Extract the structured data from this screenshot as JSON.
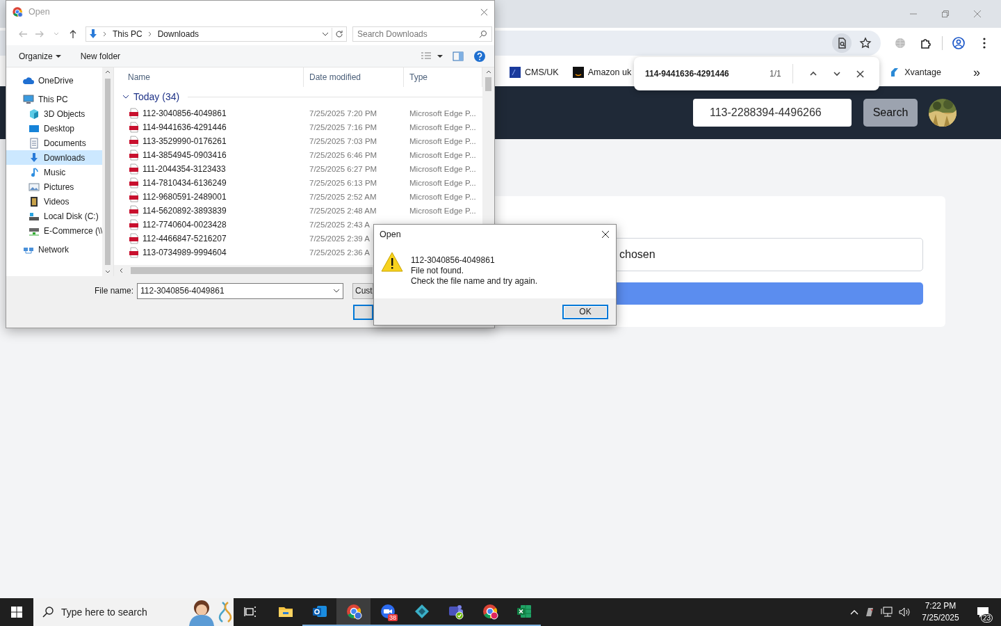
{
  "browser": {
    "bookmarks": [
      {
        "label": "CMS/UK",
        "kind": "df"
      },
      {
        "label": "Amazon uk",
        "kind": "amazon"
      }
    ],
    "bookmarks_right": [
      {
        "label": "Xvantage",
        "kind": "xvantage"
      }
    ],
    "bookmarks_overflow": "»",
    "find_bar": {
      "query": "114-9441636-4291446",
      "count": "1/1"
    },
    "header": {
      "search_value": "113-2288394-4496266",
      "search_button": "Search"
    },
    "upload_card": {
      "file_status": "chosen"
    }
  },
  "file_dialog": {
    "title": "Open",
    "path": [
      "This PC",
      "Downloads"
    ],
    "search_placeholder": "Search Downloads",
    "toolbar": [
      "Organize",
      "New folder"
    ],
    "sidebar": [
      {
        "label": "OneDrive",
        "kind": "onedrive",
        "selected": false
      },
      {
        "label": "This PC",
        "kind": "pc",
        "selected": false,
        "children": [
          {
            "label": "3D Objects",
            "kind": "objects3d",
            "selected": false
          },
          {
            "label": "Desktop",
            "kind": "desktop",
            "selected": false
          },
          {
            "label": "Documents",
            "kind": "documents",
            "selected": false
          },
          {
            "label": "Downloads",
            "kind": "downloads",
            "selected": true
          },
          {
            "label": "Music",
            "kind": "music",
            "selected": false
          },
          {
            "label": "Pictures",
            "kind": "pictures",
            "selected": false
          },
          {
            "label": "Videos",
            "kind": "videos",
            "selected": false
          },
          {
            "label": "Local Disk (C:)",
            "kind": "disk",
            "selected": false
          },
          {
            "label": "E-Commerce (\\\\",
            "kind": "netdrive",
            "selected": false
          }
        ]
      },
      {
        "label": "Network",
        "kind": "network",
        "selected": false
      }
    ],
    "columns": [
      "Name",
      "Date modified",
      "Type"
    ],
    "group": "Today (34)",
    "files": [
      {
        "name": "112-3040856-4049861",
        "date": "7/25/2025 7:20 PM",
        "type": "Microsoft Edge P..."
      },
      {
        "name": "114-9441636-4291446",
        "date": "7/25/2025 7:16 PM",
        "type": "Microsoft Edge P..."
      },
      {
        "name": "113-3529990-0176261",
        "date": "7/25/2025 7:03 PM",
        "type": "Microsoft Edge P..."
      },
      {
        "name": "114-3854945-0903416",
        "date": "7/25/2025 6:46 PM",
        "type": "Microsoft Edge P..."
      },
      {
        "name": "111-2044354-3123433",
        "date": "7/25/2025 6:27 PM",
        "type": "Microsoft Edge P..."
      },
      {
        "name": "114-7810434-6136249",
        "date": "7/25/2025 6:13 PM",
        "type": "Microsoft Edge P..."
      },
      {
        "name": "112-9680591-2489001",
        "date": "7/25/2025 2:52 AM",
        "type": "Microsoft Edge P..."
      },
      {
        "name": "114-5620892-3893839",
        "date": "7/25/2025 2:48 AM",
        "type": "Microsoft Edge P..."
      },
      {
        "name": "112-7740604-0023428",
        "date": "7/25/2025 2:43 A"
      },
      {
        "name": "112-4466847-5216207",
        "date": "7/25/2025 2:39 A"
      },
      {
        "name": "113-0734989-9994604",
        "date": "7/25/2025 2:36 A"
      }
    ],
    "file_name_label": "File name:",
    "file_name": "112-3040856-4049861",
    "filter": "Cust"
  },
  "message_box": {
    "title": "Open",
    "lines": [
      "112-3040856-4049861",
      "File not found.",
      "Check the file name and try again."
    ],
    "button": "OK"
  },
  "taskbar": {
    "search_placeholder": "Type here to search",
    "apps": [
      {
        "kind": "explorer",
        "running": false,
        "selected": false
      },
      {
        "kind": "outlook",
        "running": true,
        "selected": false
      },
      {
        "kind": "chrome",
        "running": true,
        "selected": true
      },
      {
        "kind": "zoom",
        "running": true,
        "selected": false,
        "badge": "38"
      },
      {
        "kind": "diamond",
        "running": true,
        "selected": false
      },
      {
        "kind": "teams",
        "running": true,
        "selected": false
      },
      {
        "kind": "chrome",
        "running": true,
        "selected": false
      },
      {
        "kind": "excel",
        "running": true,
        "selected": false
      }
    ],
    "time": "7:22 PM",
    "date": "7/25/2025",
    "notifications": "23"
  }
}
